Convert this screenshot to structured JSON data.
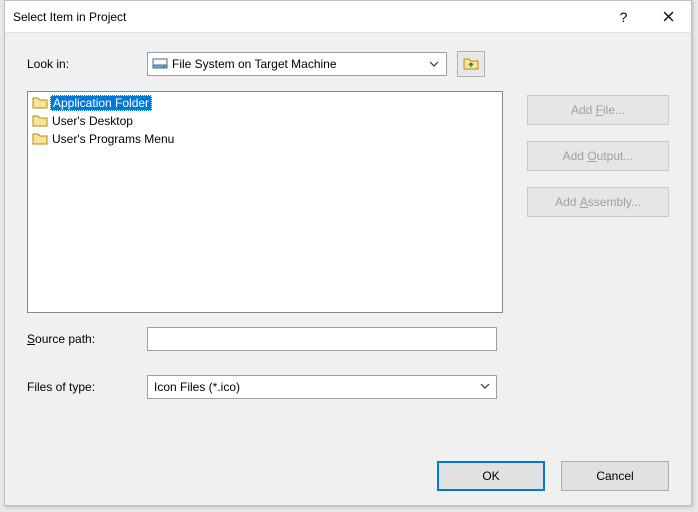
{
  "title": "Select Item in Project",
  "labels": {
    "look_in": "Look in:",
    "source_path": "Source path:",
    "files_of_type": "Files of type:"
  },
  "look_in_value": "File System on Target Machine",
  "folders": [
    {
      "label": "Application Folder",
      "selected": true
    },
    {
      "label": "User's Desktop",
      "selected": false
    },
    {
      "label": "User's Programs Menu",
      "selected": false
    }
  ],
  "side_buttons": {
    "add_file": "Add File...",
    "add_output": "Add Output...",
    "add_assembly": "Add Assembly..."
  },
  "source_path_value": "",
  "files_of_type_value": "Icon Files (*.ico)",
  "buttons": {
    "ok": "OK",
    "cancel": "Cancel"
  },
  "icons": {
    "help": "?",
    "close": "✕"
  }
}
